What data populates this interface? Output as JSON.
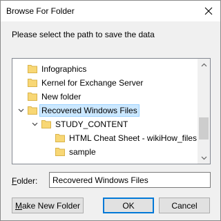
{
  "window": {
    "title": "Browse For Folder",
    "close_icon": "close-icon"
  },
  "prompt": "Please select the path to save the data",
  "tree": {
    "items": [
      {
        "label": "Infographics",
        "indent": 0,
        "expander": "none",
        "selected": false
      },
      {
        "label": "Kernel for Exchange Server",
        "indent": 0,
        "expander": "none",
        "selected": false
      },
      {
        "label": "New folder",
        "indent": 0,
        "expander": "none",
        "selected": false
      },
      {
        "label": "Recovered Windows Files",
        "indent": 0,
        "expander": "expanded",
        "selected": true
      },
      {
        "label": "STUDY_CONTENT",
        "indent": 1,
        "expander": "expanded",
        "selected": false
      },
      {
        "label": "HTML Cheat Sheet - wikiHow_files",
        "indent": 2,
        "expander": "none",
        "selected": false
      },
      {
        "label": "sample",
        "indent": 2,
        "expander": "none",
        "selected": false
      }
    ]
  },
  "folder_field": {
    "label_accel": "F",
    "label_rest": "older:",
    "value": "Recovered Windows Files"
  },
  "buttons": {
    "new_folder_accel": "M",
    "new_folder_rest": "ake New Folder",
    "ok": "OK",
    "cancel": "Cancel"
  },
  "colors": {
    "selection_bg": "#cce8ff",
    "selection_border": "#99d1ff",
    "folder_yellow": "#f8d775",
    "default_button_border": "#0078d7"
  }
}
